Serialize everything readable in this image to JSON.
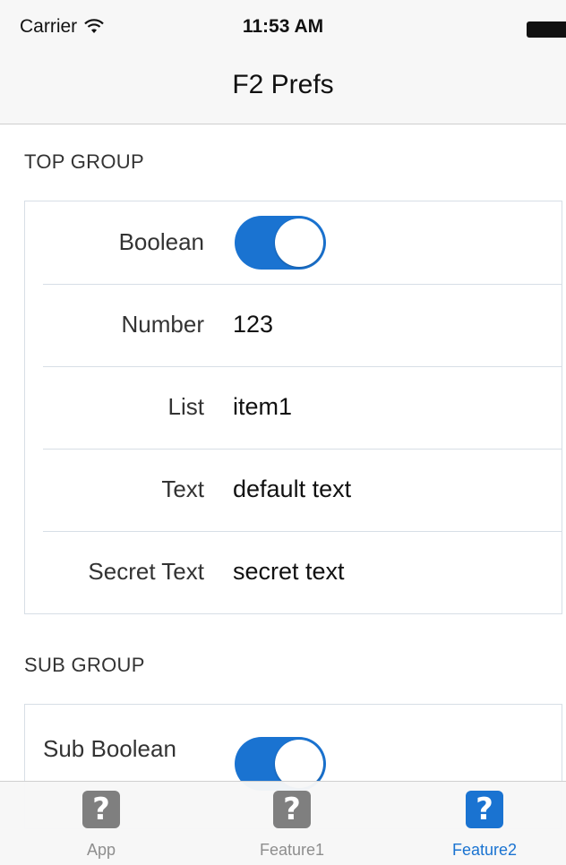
{
  "status_bar": {
    "carrier": "Carrier",
    "time": "11:53 AM"
  },
  "nav": {
    "title": "F2 Prefs"
  },
  "top_group": {
    "header": "TOP GROUP",
    "rows": [
      {
        "label": "Boolean",
        "type": "toggle",
        "value": true
      },
      {
        "label": "Number",
        "type": "text",
        "value": "123"
      },
      {
        "label": "List",
        "type": "text",
        "value": "item1"
      },
      {
        "label": "Text",
        "type": "text",
        "value": "default text"
      },
      {
        "label": "Secret Text",
        "type": "text",
        "value": "secret text"
      }
    ]
  },
  "sub_group": {
    "header": "SUB GROUP",
    "rows": [
      {
        "label": "Sub Boolean",
        "type": "toggle",
        "value": true
      }
    ]
  },
  "tab_bar": {
    "tabs": [
      {
        "label": "App",
        "icon": "question-icon",
        "active": false
      },
      {
        "label": "Feature1",
        "icon": "question-icon",
        "active": false
      },
      {
        "label": "Feature2",
        "icon": "question-icon",
        "active": true
      }
    ],
    "icon_glyph": "?"
  },
  "colors": {
    "accent": "#1a73d1",
    "inactive_icon": "#7f7f7f",
    "inactive_text": "#8e8e8e"
  }
}
